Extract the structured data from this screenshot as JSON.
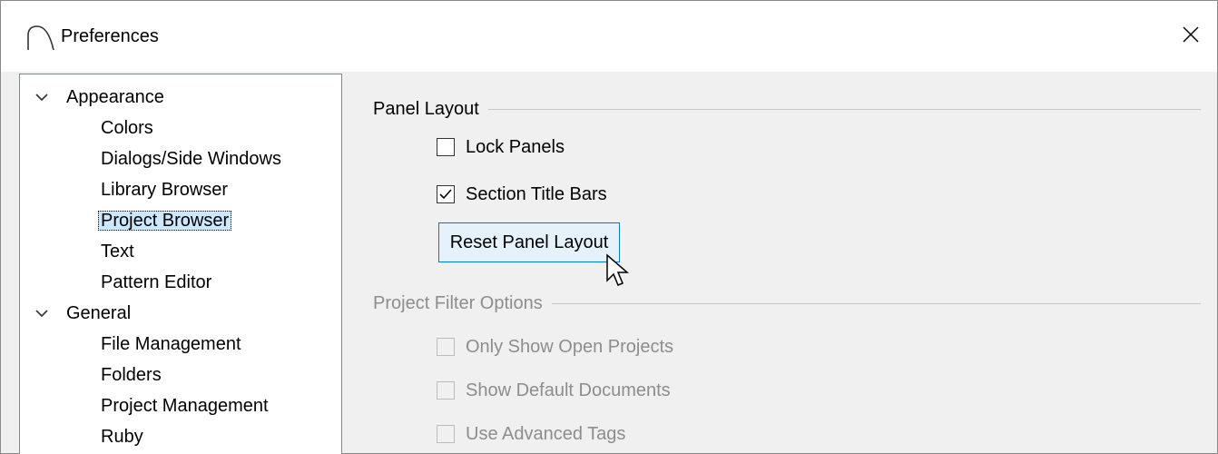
{
  "window": {
    "title": "Preferences",
    "close_glyph": "✕"
  },
  "tree": {
    "items": [
      {
        "label": "Appearance",
        "expanded": true
      },
      {
        "label": "Colors"
      },
      {
        "label": "Dialogs/Side Windows"
      },
      {
        "label": "Library Browser"
      },
      {
        "label": "Project Browser",
        "selected": true
      },
      {
        "label": "Text"
      },
      {
        "label": "Pattern Editor"
      },
      {
        "label": "General",
        "expanded": true
      },
      {
        "label": "File Management"
      },
      {
        "label": "Folders"
      },
      {
        "label": "Project Management"
      },
      {
        "label": "Ruby"
      }
    ]
  },
  "panel_layout": {
    "title": "Panel Layout",
    "lock_panels": {
      "label": "Lock Panels",
      "checked": false
    },
    "section_title_bars": {
      "label": "Section Title Bars",
      "checked": true
    },
    "reset_button": "Reset Panel Layout"
  },
  "project_filter": {
    "title": "Project Filter Options",
    "only_show_open": {
      "label": "Only Show Open Projects",
      "checked": false,
      "enabled": false
    },
    "show_default_docs": {
      "label": "Show Default Documents",
      "checked": false,
      "enabled": false
    },
    "use_advanced_tags": {
      "label": "Use Advanced Tags",
      "checked": false,
      "enabled": false
    }
  },
  "colors": {
    "selection": "#cce8ff",
    "button_focus_border": "#0078d7",
    "disabled_text": "#8d8d8d"
  }
}
